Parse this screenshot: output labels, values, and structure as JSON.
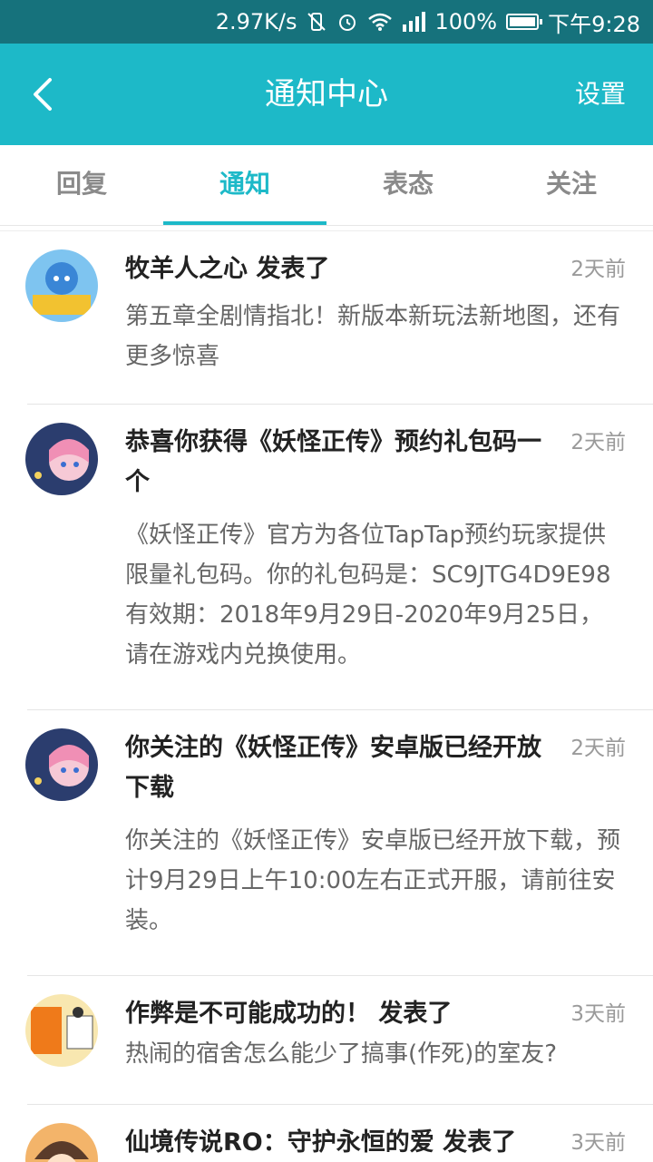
{
  "status": {
    "speed": "2.97K/s",
    "battery": "100%",
    "time": "下午9:28"
  },
  "appbar": {
    "title": "通知中心",
    "settings": "设置"
  },
  "tabs": [
    "回复",
    "通知",
    "表态",
    "关注"
  ],
  "items": [
    {
      "title": "牧羊人之心 发表了",
      "time": "2天前",
      "body": "第五章全剧情指北！新版本新玩法新地图，还有更多惊喜"
    },
    {
      "title": "恭喜你获得《妖怪正传》预约礼包码一个",
      "time": "2天前",
      "body": "《妖怪正传》官方为各位TapTap预约玩家提供限量礼包码。你的礼包码是：SC9JTG4D9E98 有效期：2018年9月29日-2020年9月25日，请在游戏内兑换使用。"
    },
    {
      "title": "你关注的《妖怪正传》安卓版已经开放下载",
      "time": "2天前",
      "body": "你关注的《妖怪正传》安卓版已经开放下载，预计9月29日上午10:00左右正式开服，请前往安装。"
    },
    {
      "title": "作弊是不可能成功的！ 发表了",
      "time": "3天前",
      "body": "热闹的宿舍怎么能少了搞事(作死)的室友?"
    },
    {
      "title": "仙境传说RO：守护永恒的爱 发表了",
      "time": "3天前",
      "body": ""
    }
  ]
}
